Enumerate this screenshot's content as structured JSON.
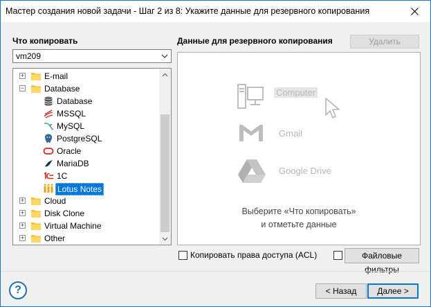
{
  "window": {
    "title": "Мастер создания новой задачи - Шаг 2 из 8: Укажите данные для резервного копирования"
  },
  "left": {
    "heading": "Что копировать",
    "source_select": {
      "value": "vm209"
    },
    "tree": [
      {
        "label": "E-mail",
        "icon": "folder-icon",
        "expander": "+",
        "level": 0
      },
      {
        "label": "Database",
        "icon": "folder-icon",
        "expander": "−",
        "level": 0
      },
      {
        "label": "Database",
        "icon": "database-icon",
        "level": 1
      },
      {
        "label": "MSSQL",
        "icon": "mssql-icon",
        "level": 1
      },
      {
        "label": "MySQL",
        "icon": "mysql-icon",
        "level": 1
      },
      {
        "label": "PostgreSQL",
        "icon": "postgresql-icon",
        "level": 1
      },
      {
        "label": "Oracle",
        "icon": "oracle-icon",
        "level": 1
      },
      {
        "label": "MariaDB",
        "icon": "mariadb-icon",
        "level": 1
      },
      {
        "label": "1C",
        "icon": "1c-icon",
        "level": 1
      },
      {
        "label": "Lotus Notes",
        "icon": "lotus-notes-icon",
        "level": 1,
        "selected": true
      },
      {
        "label": "Cloud",
        "icon": "folder-icon",
        "expander": "+",
        "level": 0
      },
      {
        "label": "Disk Clone",
        "icon": "folder-icon",
        "expander": "+",
        "level": 0
      },
      {
        "label": "Virtual Machine",
        "icon": "folder-icon",
        "expander": "+",
        "level": 0
      },
      {
        "label": "Other",
        "icon": "folder-icon",
        "expander": "+",
        "level": 0
      }
    ]
  },
  "right": {
    "heading": "Данные для резервного копирования",
    "delete_label": "Удалить",
    "services": [
      {
        "label": "Computer",
        "icon": "computer-icon",
        "hovered": true
      },
      {
        "label": "Gmail",
        "icon": "gmail-icon"
      },
      {
        "label": "Google Drive",
        "icon": "google-drive-icon"
      }
    ],
    "hint_line1": "Выберите «Что копировать»",
    "hint_line2": "и отметьте данные"
  },
  "options": {
    "acl_label": "Копировать права доступа (ACL)",
    "file_filters_label": "Файловые фильтры"
  },
  "footer": {
    "help": "?",
    "back_label": "< Назад",
    "next_label": "Далее >"
  },
  "colors": {
    "selection": "#0078d7",
    "folder": "#f5c342",
    "help": "#1f6fb5"
  }
}
